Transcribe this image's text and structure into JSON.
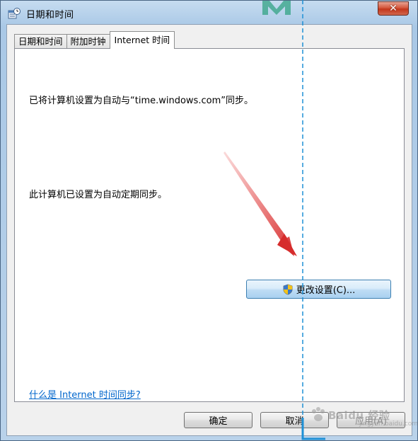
{
  "window": {
    "title": "日期和时间",
    "close_glyph": "✕"
  },
  "tabs": [
    {
      "label": "日期和时间",
      "active": false
    },
    {
      "label": "附加时钟",
      "active": false
    },
    {
      "label": "Internet 时间",
      "active": true
    }
  ],
  "panel": {
    "sync_server_text": "已将计算机设置为自动与“time.windows.com”同步。",
    "auto_sync_text": "此计算机已设置为自动定期同步。",
    "change_settings_label": "更改设置(C)...",
    "help_link": "什么是 Internet 时间同步?"
  },
  "buttons": {
    "ok": "确定",
    "cancel": "取消",
    "apply": "应用(A)"
  },
  "watermark": {
    "brand": "Baidu 经验",
    "sub": "jingyan.baidu.com"
  },
  "colors": {
    "annotation_arrow": "#e03c3c",
    "annotation_line": "#1e90d6",
    "link": "#0066cc"
  },
  "icons": {
    "title": "clock-settings-icon",
    "change_settings": "uac-shield-icon"
  }
}
